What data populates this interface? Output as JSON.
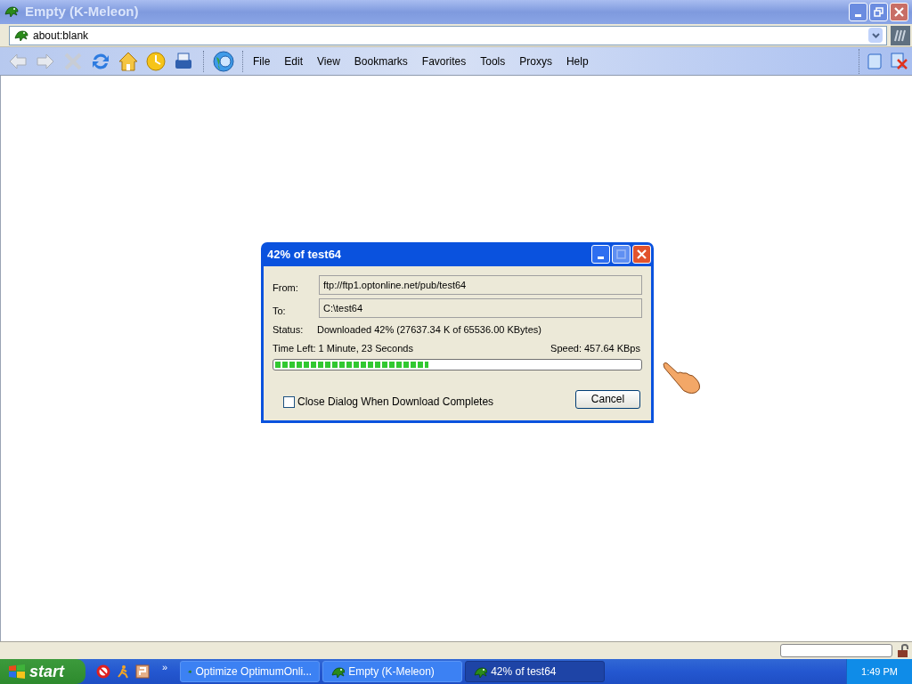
{
  "window": {
    "title": "Empty (K-Meleon)"
  },
  "address": {
    "value": "about:blank"
  },
  "menu": [
    "File",
    "Edit",
    "View",
    "Bookmarks",
    "Favorites",
    "Tools",
    "Proxys",
    "Help"
  ],
  "dialog": {
    "title": "42% of test64",
    "fields": [
      {
        "label": "From:",
        "value": "ftp://ftp1.optonline.net/pub/test64"
      },
      {
        "label": "To:",
        "value": "C:\\test64"
      }
    ],
    "status_label": "Status:",
    "status": "Downloaded 42% (27637.34 K of 65536.00 KBytes)",
    "time_left": "Time Left: 1 Minute, 23 Seconds",
    "speed": "Speed: 457.64 KBps",
    "progress": {
      "level": 0.42
    },
    "close_when_done": {
      "label": "Close Dialog When Download Completes",
      "checked": false
    },
    "cancel": "Cancel"
  },
  "taskbar": {
    "start": "start",
    "chevron": "»",
    "tasks": [
      {
        "label": "Optimize OptimumOnli...",
        "selected": false
      },
      {
        "label": "Empty (K-Meleon)",
        "selected": false
      },
      {
        "label": "42% of test64",
        "selected": true
      }
    ],
    "clock": "1:49 PM"
  }
}
